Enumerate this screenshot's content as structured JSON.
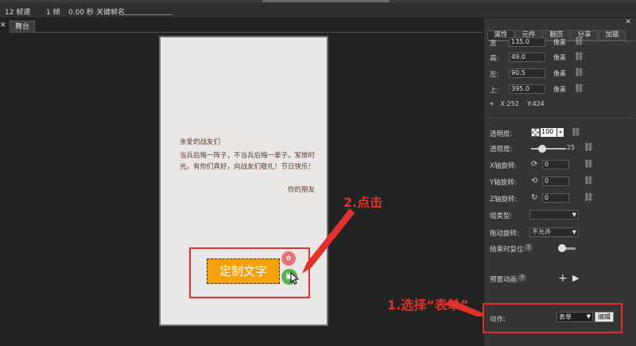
{
  "topbar": {
    "fps": "12 帧速",
    "frames": "1 帧",
    "seconds": "0.00 秒",
    "keyframe_label": "关键帧名"
  },
  "canvas": {
    "close_glyph": "✕",
    "stage_tab": "舞台"
  },
  "phone": {
    "greeting": "亲爱的战友们",
    "body": "当兵后悔一阵子，不当兵后悔一辈子。军旅时光，有你们真好，向战友们敬礼！节日快乐！",
    "signature": "你的朋友",
    "button_label": "定制文字"
  },
  "annotations": {
    "step2": "2.点击",
    "step1": "1.选择“表单”",
    "color": "#e0312a"
  },
  "panel": {
    "close_glyph": "✕",
    "tabs": [
      "属性",
      "元件",
      "翻页",
      "分享",
      "加载"
    ],
    "fields": {
      "width": {
        "label": "宽",
        "value": "135.0",
        "unit": "像素"
      },
      "height": {
        "label": "高:",
        "value": "49.0",
        "unit": "像素"
      },
      "left": {
        "label": "左:",
        "value": "90.5",
        "unit": "像素"
      },
      "top": {
        "label": "上:",
        "value": "395.0",
        "unit": "像素"
      }
    },
    "coords": {
      "plus": "+",
      "x": "X:252",
      "y": "Y:424"
    },
    "opacity": {
      "label": "透明度:",
      "value": "100"
    },
    "perspective": {
      "label": "透视度:",
      "value": "25",
      "level": 0.25
    },
    "x_rotate": {
      "label": "X轴旋转:",
      "value": "0"
    },
    "y_rotate": {
      "label": "Y轴旋转:",
      "value": "0"
    },
    "z_rotate": {
      "label": "Z轴旋转:",
      "value": "0"
    },
    "group_type": {
      "label": "组类型:",
      "value": ""
    },
    "drag_rotate": {
      "label": "拖动旋转:",
      "value": "不允许"
    },
    "reset_on_end": {
      "label": "结束时复位:",
      "help": "?"
    },
    "preset_anim": {
      "label": "预置动画:",
      "help": "?",
      "plus": "+",
      "play": "▶"
    },
    "action": {
      "label": "动作:",
      "value": "表单",
      "edit_label": "编辑"
    }
  }
}
